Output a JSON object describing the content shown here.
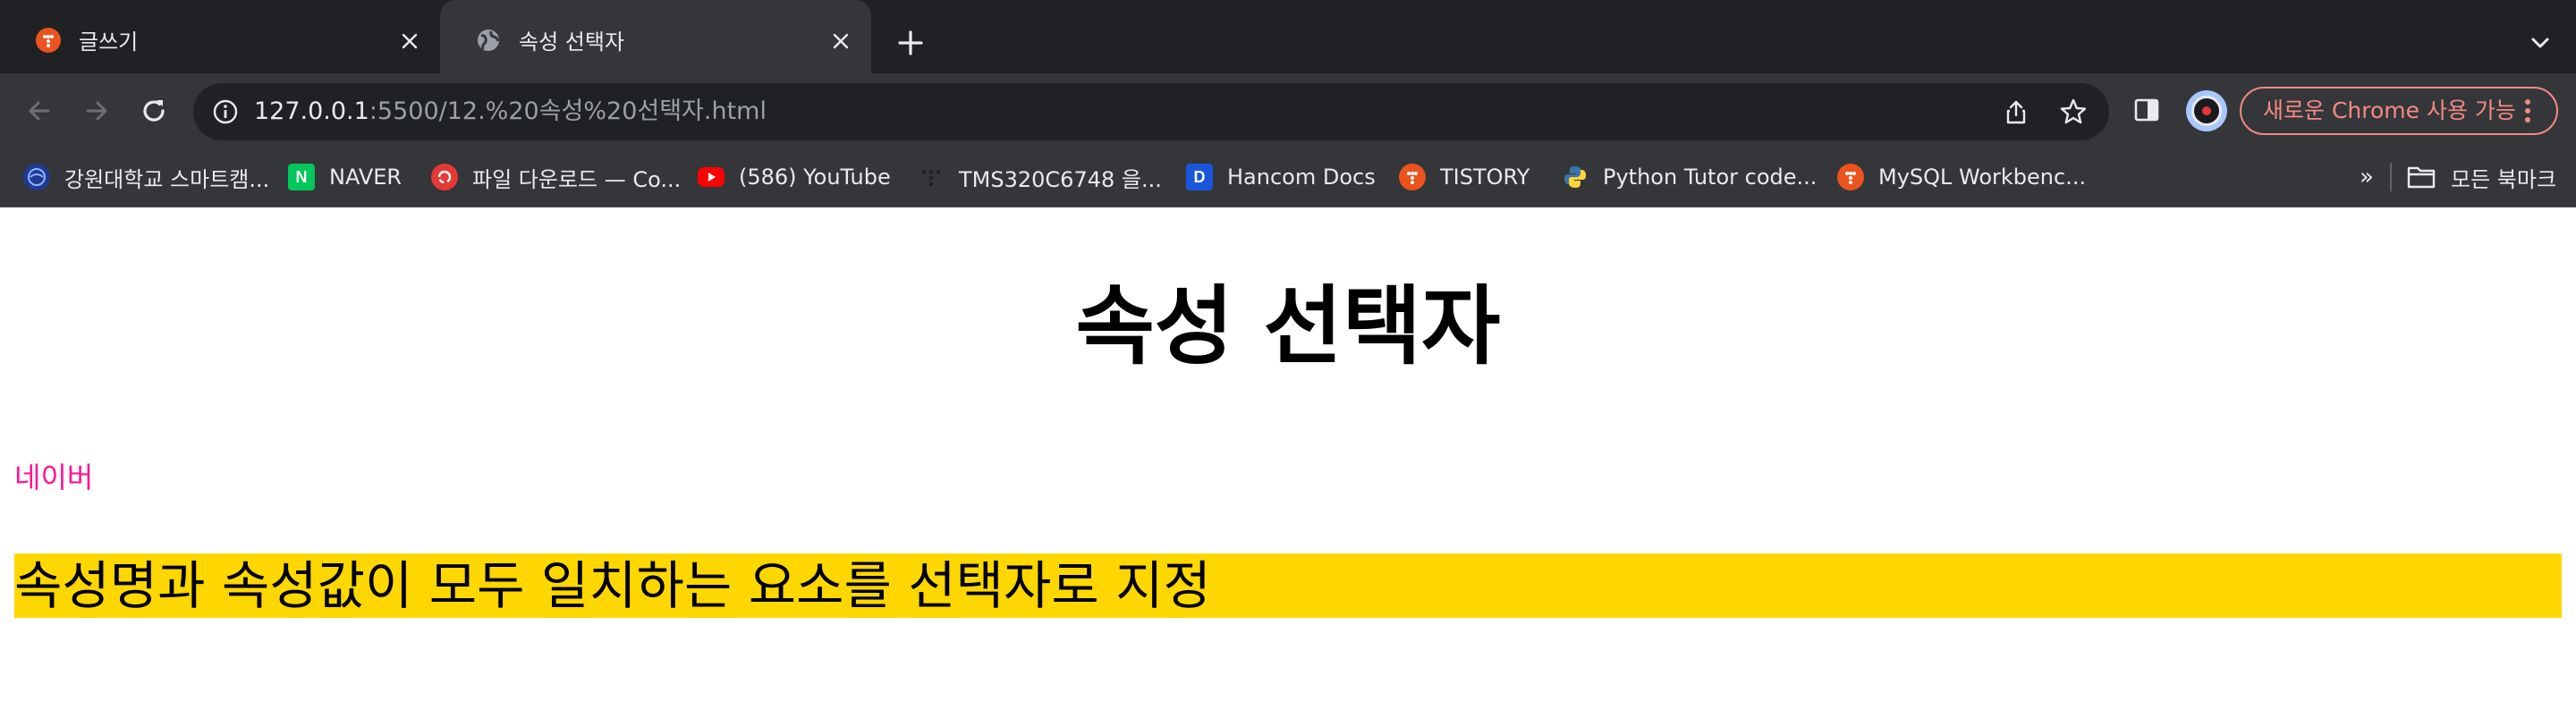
{
  "tabs": [
    {
      "title": "글쓰기",
      "favicon": "tistory-icon",
      "active": false
    },
    {
      "title": "속성 선택자",
      "favicon": "globe-icon",
      "active": true
    }
  ],
  "address_bar": {
    "url_host": "127.0.0.1",
    "url_path": ":5500/12.%20속성%20선택자.html"
  },
  "update_button": {
    "label": "새로운 Chrome 사용 가능"
  },
  "bookmarks": [
    {
      "label": "강원대학교 스마트캠...",
      "icon": "kangwon-icon",
      "color": "#1f3a93"
    },
    {
      "label": "NAVER",
      "icon": "naver-icon",
      "color": "#03c75a"
    },
    {
      "label": "파일 다운로드 — Co...",
      "icon": "download-icon",
      "color": "#e53935"
    },
    {
      "label": "(586) YouTube",
      "icon": "youtube-icon",
      "color": "#ff0000"
    },
    {
      "label": "TMS320C6748 을...",
      "icon": "dots-icon",
      "color": "#202124"
    },
    {
      "label": "Hancom Docs",
      "icon": "hancom-icon",
      "color": "#1a56db"
    },
    {
      "label": "TISTORY",
      "icon": "tistory-icon",
      "color": "#eb531f"
    },
    {
      "label": "Python Tutor code...",
      "icon": "python-icon",
      "color": "#3776ab"
    },
    {
      "label": "MySQL Workbenc...",
      "icon": "tistory-icon",
      "color": "#eb531f"
    }
  ],
  "bookmarks_more": "»",
  "all_bookmarks": {
    "label": "모든 북마크",
    "icon": "folder-icon"
  },
  "page": {
    "title": "속성 선택자",
    "link_text": "네이버",
    "highlight_text": "속성명과 속성값이 모두 일치하는 요소를 선택자로 지정"
  },
  "colors": {
    "link": "#ff1493",
    "highlight_bg": "#ffd700",
    "tabstrip_bg": "#202124",
    "toolbar_bg": "#35363a",
    "update_accent": "#f28b82"
  }
}
